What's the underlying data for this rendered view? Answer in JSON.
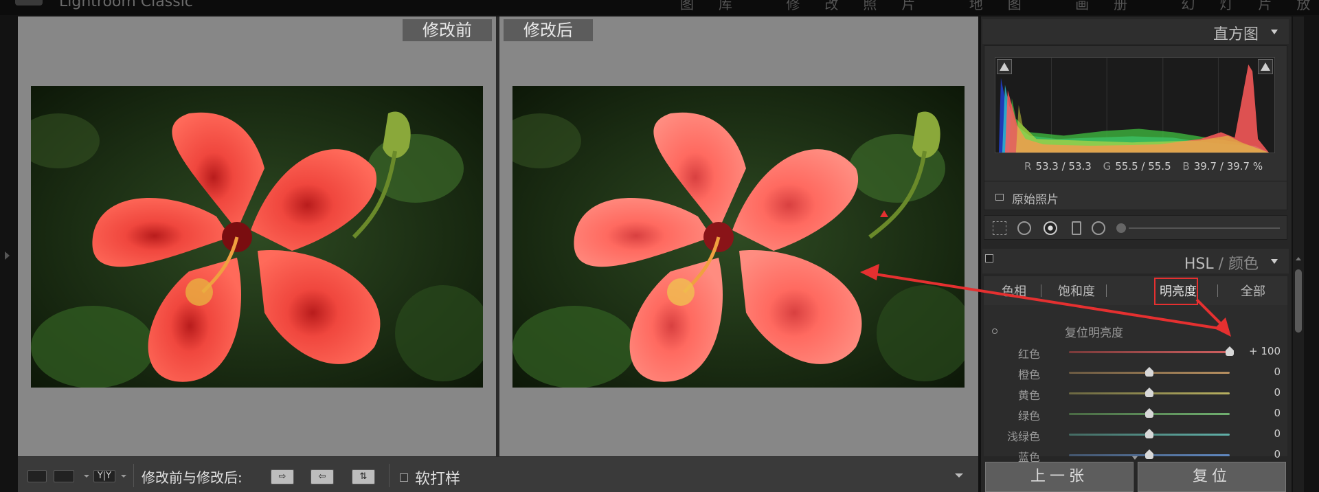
{
  "app": {
    "title": "Lightroom Classic",
    "modules": "图库 修改照片 地图 画册 幻灯片放映 打印 Web"
  },
  "compare": {
    "before_label": "修改前",
    "after_label": "修改后"
  },
  "toolbar": {
    "view_yy": "Y|Y",
    "before_after_label": "修改前与修改后:",
    "copy_before_to_after": "⇨",
    "copy_after_to_before": "⇦",
    "swap": "⇅",
    "soft_proof_label": "软打样"
  },
  "histogram": {
    "title": "直方图",
    "readout": {
      "r_key": "R",
      "r_val": "53.3 / 53.3",
      "g_key": "G",
      "g_val": "55.5 / 55.5",
      "b_key": "B",
      "b_val": "39.7 / 39.7 %"
    },
    "original_photo_label": "原始照片"
  },
  "hsl": {
    "title_main": "HSL",
    "title_sep": " / ",
    "title_alt": "颜色",
    "tabs": [
      "色相",
      "饱和度",
      "明亮度",
      "全部"
    ],
    "active_tab_index": 2,
    "reset_label": "复位明亮度",
    "sliders": [
      {
        "label": "红色",
        "value": "+ 100",
        "fraction": 1.0,
        "color_left": "#7a3a3a",
        "color_right": "#d06060"
      },
      {
        "label": "橙色",
        "value": "0",
        "fraction": 0.5,
        "color_left": "#6b5a42",
        "color_right": "#b89060"
      },
      {
        "label": "黄色",
        "value": "0",
        "fraction": 0.5,
        "color_left": "#6b6742",
        "color_right": "#b8b060"
      },
      {
        "label": "绿色",
        "value": "0",
        "fraction": 0.5,
        "color_left": "#4a6a44",
        "color_right": "#70b070"
      },
      {
        "label": "浅绿色",
        "value": "0",
        "fraction": 0.5,
        "color_left": "#446a62",
        "color_right": "#60b0a8"
      },
      {
        "label": "蓝色",
        "value": "0",
        "fraction": 0.5,
        "color_left": "#44566e",
        "color_right": "#6088c0"
      }
    ]
  },
  "footer": {
    "prev_label": "上一张",
    "reset_label": "复位"
  },
  "colors": {
    "annotation": "#e53030",
    "panel_bg": "#262626",
    "canvas_gray": "#878787"
  }
}
